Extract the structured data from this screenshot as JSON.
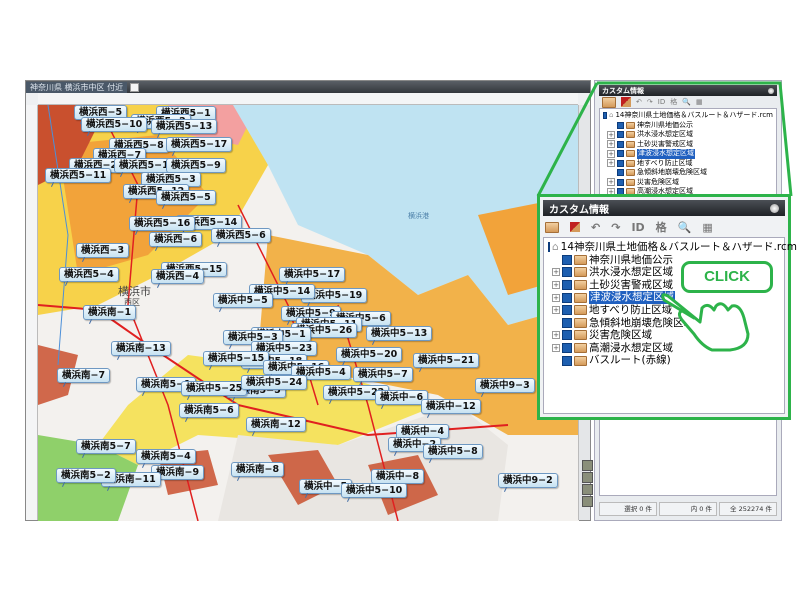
{
  "window": {
    "title": "神奈川県 横浜市中区 付近"
  },
  "map": {
    "place_labels": [
      "横浜市",
      "西区",
      "横浜港"
    ],
    "labels": [
      "横浜西−5",
      "横浜西5−1",
      "横浜西5−2",
      "横浜西5−10",
      "横浜西5−13",
      "横浜西5−8",
      "横浜西5−17",
      "横浜西−7",
      "横浜西−2",
      "横浜西5−18",
      "横浜西5−9",
      "横浜西5−11",
      "横浜西5−3",
      "横浜西5−12",
      "横浜西5−5",
      "横浜西5−14",
      "横浜西5−16",
      "横浜西−6",
      "横浜西5−6",
      "横浜西−3",
      "横浜西5−15",
      "横浜西5−4",
      "横浜西−4",
      "横浜中5−17",
      "横浜中5−19",
      "横浜中5−14",
      "横浜中5−5",
      "横浜中5−9",
      "横浜中5−6",
      "横浜中5−11",
      "横浜中5−26",
      "横浜中5−13",
      "横浜中5−1",
      "横浜中5−3",
      "横浜中5−23",
      "横浜南−1",
      "横浜南−13",
      "横浜中5−18",
      "横浜中5−15",
      "横浜中5−20",
      "横浜中5−21",
      "横浜中5−16",
      "横浜中5−4",
      "横浜中5−7",
      "横浜南−7",
      "横浜南5−1",
      "横浜南5−5",
      "横浜中5−25",
      "横浜中5−24",
      "横浜中5−22",
      "横浜中−6",
      "横浜中9−3",
      "横浜南5−6",
      "横浜中−12",
      "横浜南−12",
      "横浜中−4",
      "横浜中−2",
      "横浜中5−8",
      "横浜南5−7",
      "横浜南5−4",
      "横浜南−9",
      "横浜南−8",
      "横浜南−11",
      "横浜南5−2",
      "横浜中−8",
      "横浜中9−2",
      "横浜中−5",
      "横浜中5−10"
    ]
  },
  "panel": {
    "title": "カスタム情報",
    "toolbar": [
      "folder-icon",
      "import-icon",
      "undo-icon",
      "redo-icon",
      "id-add-icon",
      "price-icon",
      "search-icon",
      "grid-icon"
    ],
    "toolbar_glyphs": [
      "",
      "",
      "↶",
      "↷",
      "ID",
      "格",
      "🔍",
      "▦"
    ],
    "root": "14神奈川県土地価格＆バスルート＆ハザード.rcm",
    "items": [
      {
        "label": "神奈川県地価公示",
        "expandable": false,
        "selected": false
      },
      {
        "label": "洪水浸水想定区域",
        "expandable": true,
        "selected": false
      },
      {
        "label": "土砂災害警戒区域",
        "expandable": true,
        "selected": false
      },
      {
        "label": "津波浸水想定区域",
        "expandable": true,
        "selected": true
      },
      {
        "label": "地すべり防止区域",
        "expandable": true,
        "selected": false
      },
      {
        "label": "急傾斜地崩壊危険区域",
        "expandable": false,
        "selected": false
      },
      {
        "label": "災害危険区域",
        "expandable": true,
        "selected": false
      },
      {
        "label": "高潮浸水想定区域",
        "expandable": true,
        "selected": false
      },
      {
        "label": "バスルート(赤線)",
        "expandable": false,
        "selected": false
      }
    ],
    "status": {
      "selected": "選択 0 件",
      "within": "内 0 件",
      "total": "全 252274 件"
    }
  },
  "callout": {
    "click_label": "CLICK"
  },
  "colors": {
    "accent": "#2db34a",
    "water": "#bfe3f2",
    "hazard_yellow": "#f7e463",
    "hazard_orange": "#f2a33a",
    "hazard_red": "#c9502e"
  }
}
